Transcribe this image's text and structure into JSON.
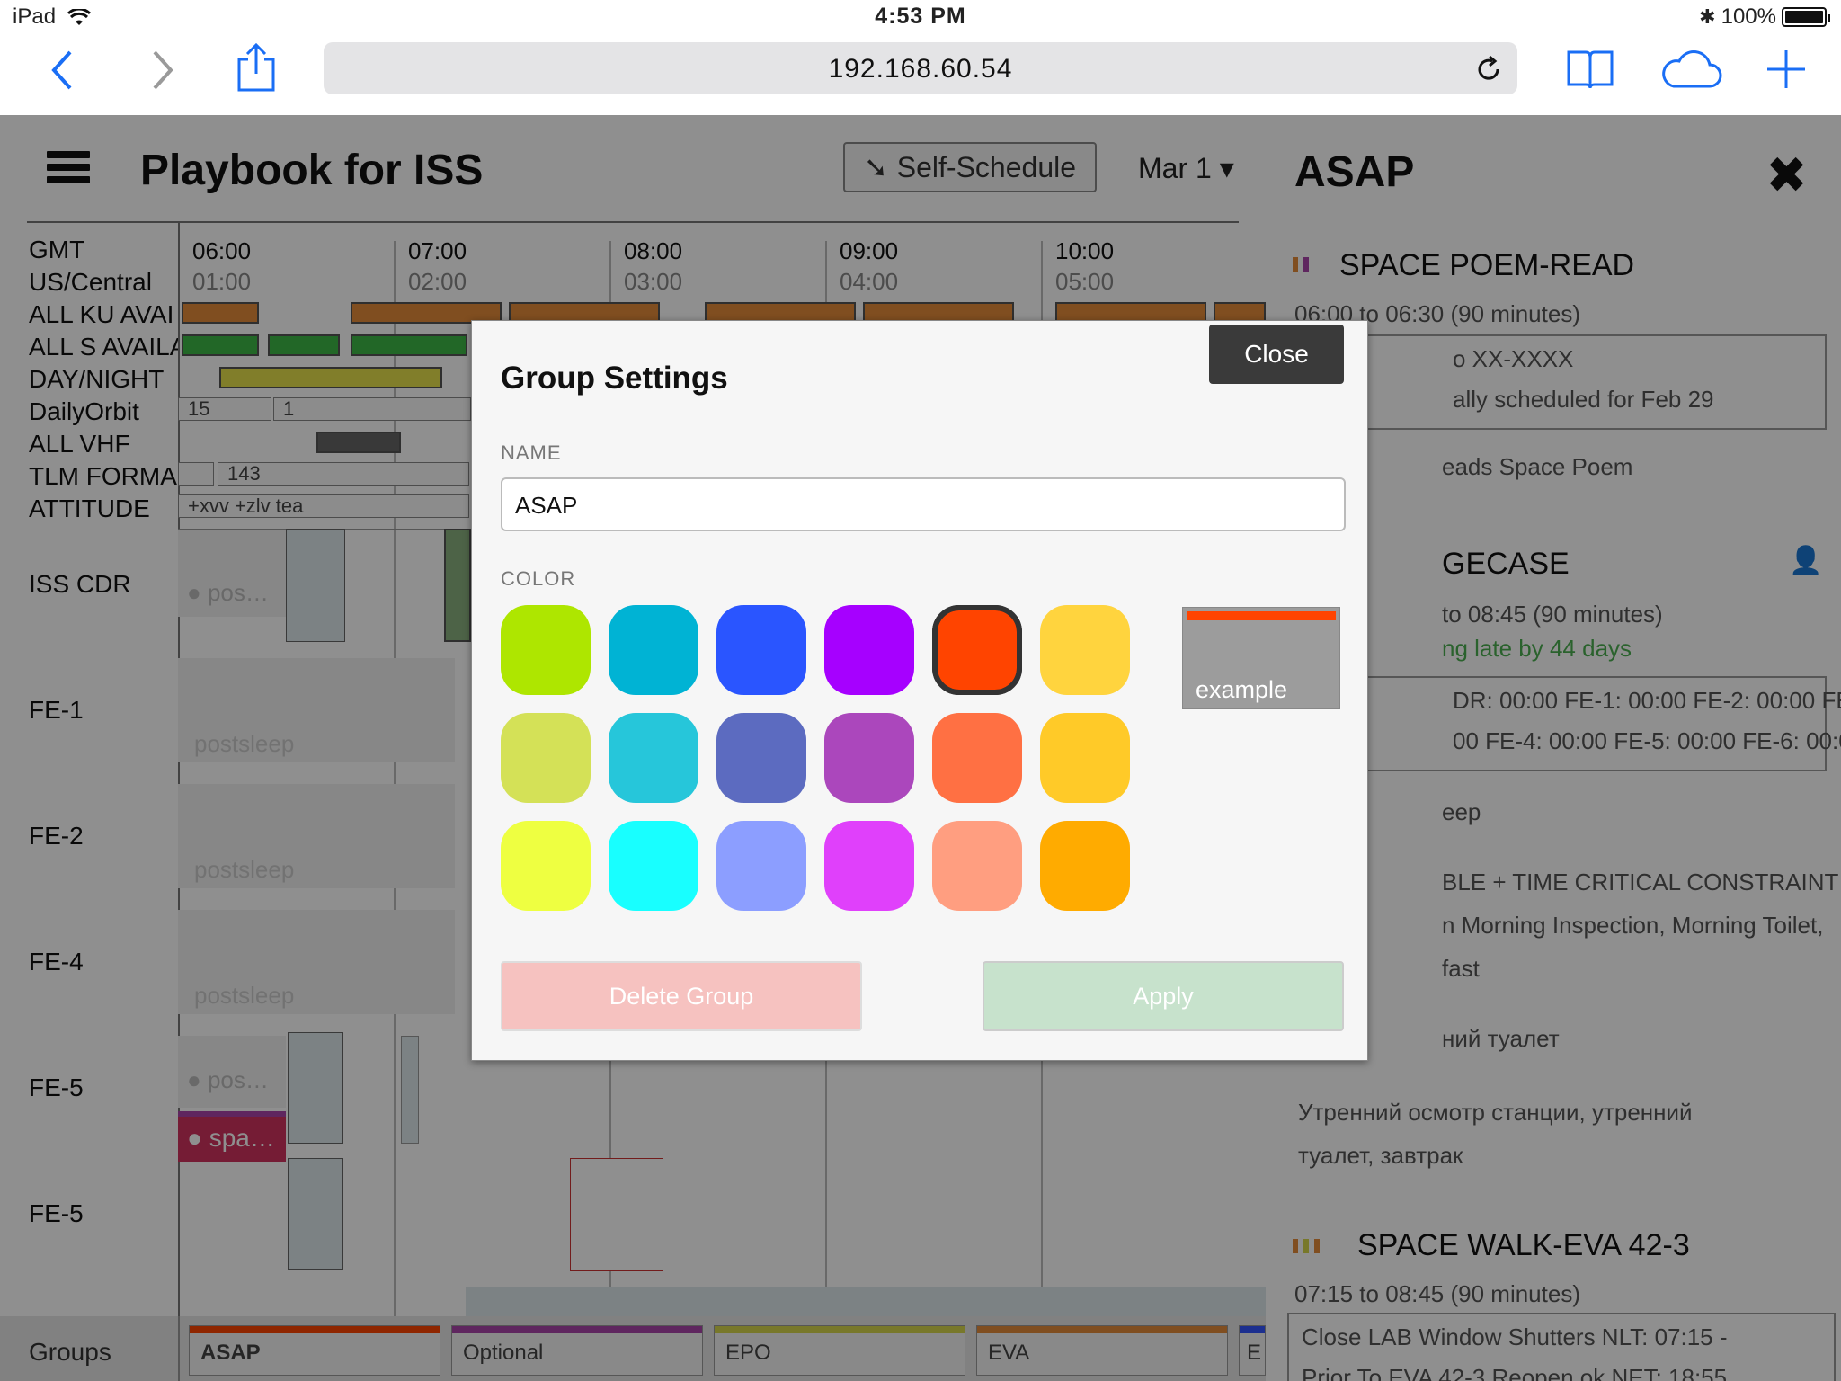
{
  "status_bar": {
    "device": "iPad",
    "time": "4:53 PM",
    "battery": "100%"
  },
  "browser": {
    "url": "192.168.60.54"
  },
  "app": {
    "title": "Playbook for ISS",
    "self_schedule_label": "Self-Schedule",
    "date_label": "Mar 1 ▾",
    "row_labels": [
      "GMT",
      "US/Central",
      "ALL KU AVAI",
      "ALL S AVAILA",
      "DAY/NIGHT",
      "DailyOrbit",
      "ALL VHF",
      "TLM FORMA",
      "ATTITUDE",
      "ISS CDR",
      "FE-1",
      "FE-2",
      "FE-4",
      "FE-5",
      "FE-5"
    ],
    "time_ticks": [
      {
        "gmt": "06:00",
        "local": "01:00"
      },
      {
        "gmt": "07:00",
        "local": "02:00"
      },
      {
        "gmt": "08:00",
        "local": "03:00"
      },
      {
        "gmt": "09:00",
        "local": "04:00"
      },
      {
        "gmt": "10:00",
        "local": "05:00"
      }
    ],
    "daily_orbit_cells": [
      "15",
      "1"
    ],
    "tlm_cell": "143",
    "attitude_cell": "+xvv +zlv tea",
    "activity_texts": {
      "cdr": "pos…",
      "fe1": "postsleep",
      "fe2": "postsleep",
      "fe4": "postsleep",
      "fe5a": "pos…",
      "fe5b": "spa…"
    },
    "groups_label": "Groups",
    "groups": [
      {
        "name": "ASAP",
        "color": "#ff4400"
      },
      {
        "name": "Optional",
        "color": "#aa44aa"
      },
      {
        "name": "EPO",
        "color": "#d6d64b"
      },
      {
        "name": "EVA",
        "color": "#e48b3a"
      },
      {
        "name": "E",
        "color": "#3355ff"
      }
    ]
  },
  "sidebar": {
    "title": "ASAP",
    "items": [
      {
        "title": "SPACE POEM-READ",
        "time": "06:00 to 06:30 (90 minutes)",
        "box": [
          "o XX-XXXX",
          "ally scheduled for Feb 29"
        ],
        "desc": "eads Space Poem"
      },
      {
        "title": "GECASE",
        "time": "to 08:45 (90 minutes)",
        "late": "ng late by 44 days",
        "box": [
          "DR: 00:00 FE-1: 00:00 FE-2: 00:00 FE-",
          "00 FE-4: 00:00 FE-5: 00:00 FE-6: 00:00"
        ],
        "desc": "eep",
        "constraint": "BLE + TIME CRITICAL CONSTRAINT",
        "c2": "n Morning Inspection, Morning Toilet,",
        "c3": "fast",
        "ru1": "ний туалет",
        "ru2": "Утренний осмотр станции, утренний",
        "ru3": "туалет, завтрак"
      },
      {
        "title": "SPACE WALK-EVA 42-3",
        "time": "07:15 to 08:45 (90 minutes)",
        "box": [
          "Close LAB Window Shutters NLT: 07:15 -",
          "Prior To EVA 42-3 Reopen ok NET: 18:55"
        ]
      }
    ]
  },
  "modal": {
    "title": "Group Settings",
    "close_label": "Close",
    "name_label": "NAME",
    "name_value": "ASAP",
    "color_label": "COLOR",
    "colors": [
      [
        "#aee600",
        "#00b3d4",
        "#2a55ff",
        "#a600ff",
        "#ff4400",
        "#ffd43e"
      ],
      [
        "#d4e157",
        "#26c6da",
        "#5c6bc0",
        "#ab47bc",
        "#ff7043",
        "#ffca28"
      ],
      [
        "#eeff41",
        "#18ffff",
        "#8c9eff",
        "#e040fb",
        "#ff9e80",
        "#ffab00"
      ]
    ],
    "selected_color": "#ff4400",
    "example_label": "example",
    "delete_label": "Delete Group",
    "apply_label": "Apply"
  }
}
